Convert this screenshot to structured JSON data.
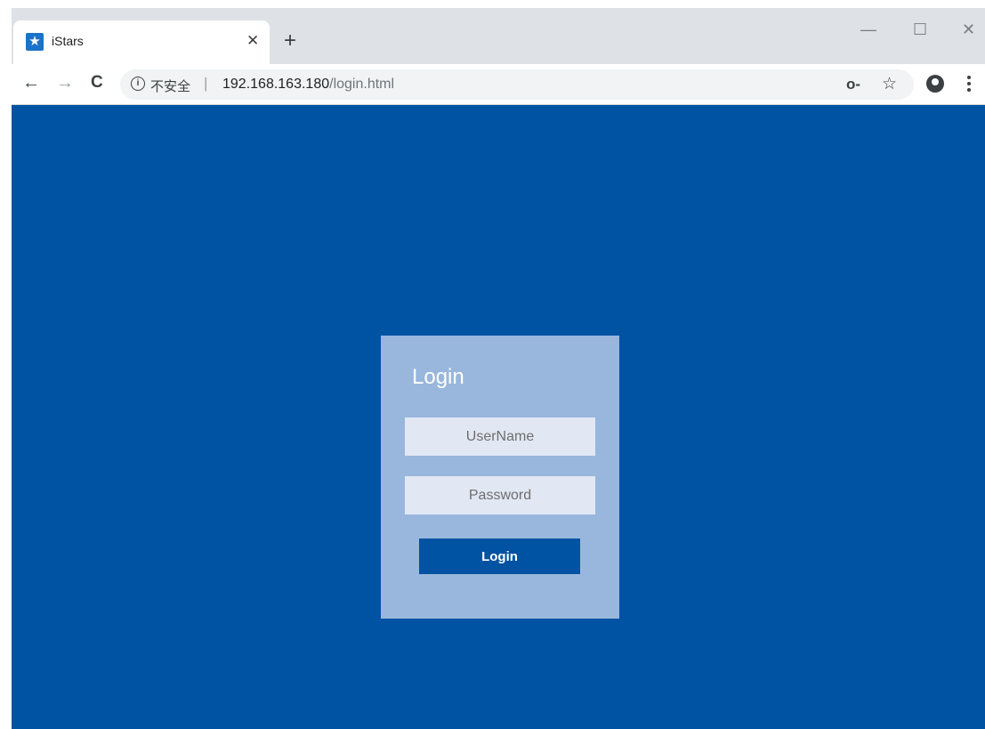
{
  "browser": {
    "tab": {
      "title": "iStars",
      "close_icon": "close-icon",
      "favicon": "star-icon"
    },
    "new_tab_label": "+",
    "window_controls": {
      "minimize": "—",
      "maximize": "☐",
      "close": "✕"
    },
    "nav": {
      "back": "←",
      "forward": "→",
      "reload": "C"
    },
    "address_bar": {
      "info_icon": "i",
      "security_text": "不安全",
      "separator": "|",
      "host": "192.168.163.180",
      "path": "/login.html"
    },
    "toolbar_icons": {
      "key": "key-icon",
      "bookmark_star": "☆"
    }
  },
  "page": {
    "background_color": "#0052a3",
    "card_color": "#99b7dc",
    "login": {
      "title": "Login",
      "username_placeholder": "UserName",
      "password_placeholder": "Password",
      "button_label": "Login"
    }
  }
}
